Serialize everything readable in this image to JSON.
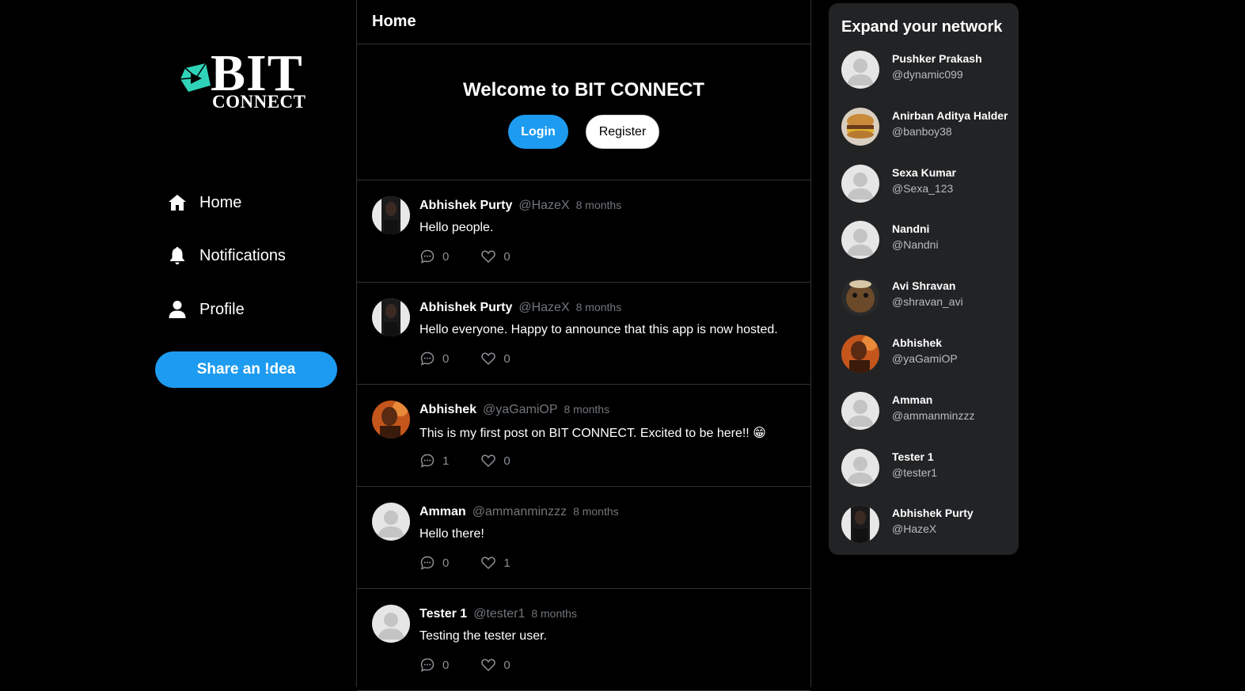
{
  "brand": {
    "logo_word": "BIT",
    "logo_subword": "CONNECT",
    "accent": "#1d9bf0",
    "logo_color": "#2fd3b8"
  },
  "nav": [
    {
      "label": "Home",
      "icon": "home-icon"
    },
    {
      "label": "Notifications",
      "icon": "bell-icon"
    },
    {
      "label": "Profile",
      "icon": "user-icon"
    }
  ],
  "share_label": "Share an !dea",
  "header": {
    "title": "Home"
  },
  "welcome": {
    "title": "Welcome to BIT CONNECT",
    "login_label": "Login",
    "register_label": "Register"
  },
  "posts": [
    {
      "name": "Abhishek Purty",
      "handle": "@HazeX",
      "time": "8 months",
      "text": "Hello people.",
      "comments": "0",
      "likes": "0",
      "avatar": "photo-dark"
    },
    {
      "name": "Abhishek Purty",
      "handle": "@HazeX",
      "time": "8 months",
      "text": "Hello everyone. Happy to announce that this app is now hosted.",
      "comments": "0",
      "likes": "0",
      "avatar": "photo-dark"
    },
    {
      "name": "Abhishek",
      "handle": "@yaGamiOP",
      "time": "8 months",
      "text": "This is my first post on BIT CONNECT. Excited to be here!! 😁",
      "comments": "1",
      "likes": "0",
      "avatar": "photo-orange"
    },
    {
      "name": "Amman",
      "handle": "@ammanminzzz",
      "time": "8 months",
      "text": "Hello there!",
      "comments": "0",
      "likes": "1",
      "avatar": "default"
    },
    {
      "name": "Tester 1",
      "handle": "@tester1",
      "time": "8 months",
      "text": "Testing the tester user.",
      "comments": "0",
      "likes": "0",
      "avatar": "default"
    }
  ],
  "suggestions_title": "Expand your network",
  "suggestions": [
    {
      "name": "Pushker Prakash",
      "handle": "@dynamic099",
      "avatar": "default"
    },
    {
      "name": "Anirban Aditya Halder",
      "handle": "@banboy38",
      "avatar": "photo-burger"
    },
    {
      "name": "Sexa Kumar",
      "handle": "@Sexa_123",
      "avatar": "default"
    },
    {
      "name": "Nandni",
      "handle": "@Nandni",
      "avatar": "default"
    },
    {
      "name": "Avi Shravan",
      "handle": "@shravan_avi",
      "avatar": "photo-cartoon"
    },
    {
      "name": "Abhishek",
      "handle": "@yaGamiOP",
      "avatar": "photo-orange"
    },
    {
      "name": "Amman",
      "handle": "@ammanminzzz",
      "avatar": "default"
    },
    {
      "name": "Tester 1",
      "handle": "@tester1",
      "avatar": "default"
    },
    {
      "name": "Abhishek Purty",
      "handle": "@HazeX",
      "avatar": "photo-dark"
    }
  ]
}
